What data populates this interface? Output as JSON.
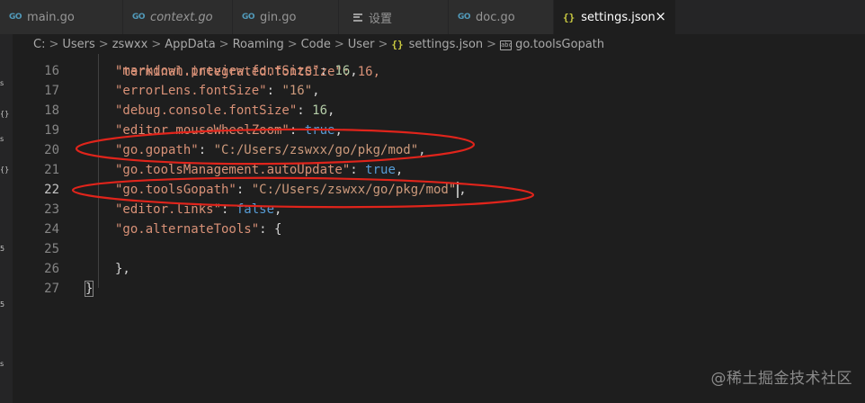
{
  "tabs": [
    {
      "label": "main.go",
      "icon": "go-file-icon",
      "badge": "GO",
      "italic": false
    },
    {
      "label": "context.go",
      "icon": "go-file-icon",
      "badge": "GO",
      "italic": true
    },
    {
      "label": "gin.go",
      "icon": "go-file-icon",
      "badge": "GO",
      "italic": false
    },
    {
      "label": "设置",
      "icon": "settings-lines-icon",
      "italic": false
    },
    {
      "label": "doc.go",
      "icon": "go-file-icon",
      "badge": "GO",
      "italic": false
    },
    {
      "label": "settings.json",
      "icon": "json-braces-icon",
      "braces": "{}",
      "close": "×",
      "active": true
    }
  ],
  "breadcrumb": {
    "items": [
      "C:",
      "Users",
      "zswxx",
      "AppData",
      "Roaming",
      "Code",
      "User",
      "settings.json",
      "go.toolsGopath"
    ],
    "separator": ">",
    "json_icon": "{}",
    "string_icon": "abc"
  },
  "editor": {
    "current_line": "22",
    "lines": [
      {
        "n": "16",
        "key": "\"markdown.preview.fontSize\"",
        "sep": ": ",
        "value": "16",
        "vtype": "num",
        "tail": ","
      },
      {
        "n": "17",
        "key": "\"errorLens.fontSize\"",
        "sep": ": ",
        "value": "\"16\"",
        "vtype": "str",
        "tail": ","
      },
      {
        "n": "18",
        "key": "\"debug.console.fontSize\"",
        "sep": ": ",
        "value": "16",
        "vtype": "num",
        "tail": ","
      },
      {
        "n": "19",
        "key": "\"editor.mouseWheelZoom\"",
        "sep": ": ",
        "value": "true",
        "vtype": "bool",
        "tail": ","
      },
      {
        "n": "20",
        "key": "\"go.gopath\"",
        "sep": ": ",
        "value": "\"C:/Users/zswxx/go/pkg/mod\"",
        "vtype": "str",
        "tail": ","
      },
      {
        "n": "21",
        "key": "\"go.toolsManagement.autoUpdate\"",
        "sep": ": ",
        "value": "true",
        "vtype": "bool",
        "tail": ","
      },
      {
        "n": "22",
        "key": "\"go.toolsGopath\"",
        "sep": ": ",
        "value": "\"C:/Users/zswxx/go/pkg/mod\"",
        "vtype": "str",
        "tail": ","
      },
      {
        "n": "23",
        "key": "\"editor.links\"",
        "sep": ": ",
        "value": "false",
        "vtype": "bool",
        "tail": ","
      },
      {
        "n": "24",
        "key": "\"go.alternateTools\"",
        "sep": ": ",
        "value": "{",
        "vtype": "punc",
        "tail": ""
      },
      {
        "n": "25",
        "key": "",
        "sep": "",
        "value": "",
        "vtype": "punc",
        "tail": ""
      },
      {
        "n": "26",
        "key": "",
        "sep": "",
        "value": "},",
        "vtype": "punc",
        "tail": ""
      },
      {
        "n": "27",
        "key": "",
        "sep": "",
        "value": "}",
        "vtype": "punc",
        "tail": ""
      }
    ],
    "partial_top_line": "\"terminal.integrated.fontSize\": 16,"
  },
  "left_strip_glyphs": [
    "s",
    "{}",
    "s",
    "{}",
    "5",
    "5",
    "s"
  ],
  "annotation_color": "#e0241b",
  "watermark": "@稀土掘金技术社区"
}
